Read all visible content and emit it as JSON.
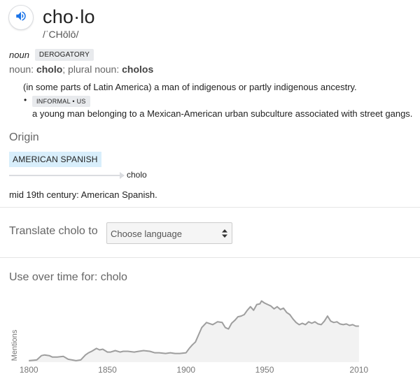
{
  "entry": {
    "headword": "cho·lo",
    "pronunciation": "/ˈCHōlō/"
  },
  "sense": {
    "part_of_speech": "noun",
    "register": "DEROGATORY",
    "forms_prefix": "noun:",
    "singular": "cholo",
    "plural_prefix": "; plural noun:",
    "plural": "cholos",
    "definition_1": "(in some parts of Latin America) a man of indigenous or partly indigenous ancestry.",
    "label_2": "INFORMAL • US",
    "definition_2": "a young man belonging to a Mexican-American urban subculture associated with street gangs."
  },
  "origin": {
    "title": "Origin",
    "source_language": "AMERICAN SPANISH",
    "target_word": "cholo",
    "text": "mid 19th century: American Spanish."
  },
  "translate": {
    "label": "Translate cholo to",
    "select_placeholder": "Choose language"
  },
  "usage": {
    "title": "Use over time for: cholo",
    "ylabel": "Mentions",
    "ticks": [
      "1800",
      "1850",
      "1900",
      "1950",
      "2010"
    ]
  },
  "colors": {
    "accent": "#1a73e8",
    "etymology_chip": "#d8eefb",
    "chart_line": "#9e9e9e",
    "chart_fill": "#f2f2f2"
  },
  "chart_data": {
    "type": "area",
    "title": "Use over time for: cholo",
    "xlabel": "",
    "ylabel": "Mentions",
    "x_ticks": [
      1800,
      1850,
      1900,
      1950,
      2010
    ],
    "xlim": [
      1795,
      2015
    ],
    "ylim": [
      0,
      100
    ],
    "grid": false,
    "x": [
      1800,
      1805,
      1808,
      1810,
      1813,
      1815,
      1818,
      1822,
      1825,
      1830,
      1833,
      1836,
      1838,
      1840,
      1843,
      1845,
      1847,
      1850,
      1852,
      1855,
      1858,
      1860,
      1863,
      1867,
      1870,
      1873,
      1877,
      1880,
      1883,
      1887,
      1890,
      1893,
      1896,
      1900,
      1902,
      1904,
      1906,
      1908,
      1910,
      1913,
      1917,
      1920,
      1923,
      1925,
      1927,
      1929,
      1931,
      1933,
      1935,
      1937,
      1939,
      1941,
      1943,
      1945,
      1947,
      1948,
      1950,
      1952,
      1954,
      1956,
      1958,
      1960,
      1962,
      1964,
      1966,
      1968,
      1970,
      1972,
      1974,
      1976,
      1978,
      1980,
      1982,
      1984,
      1986,
      1988,
      1990,
      1992,
      1994,
      1996,
      1998,
      2000,
      2002,
      2004,
      2006,
      2008,
      2010
    ],
    "values": [
      2,
      3,
      9,
      10,
      9,
      7,
      7,
      8,
      4,
      2,
      3,
      10,
      13,
      15,
      19,
      17,
      18,
      14,
      14,
      16,
      14,
      15,
      15,
      14,
      15,
      16,
      15,
      13,
      13,
      12,
      13,
      12,
      12,
      13,
      19,
      24,
      28,
      38,
      48,
      55,
      52,
      56,
      55,
      48,
      46,
      54,
      58,
      63,
      64,
      66,
      72,
      77,
      72,
      80,
      81,
      85,
      82,
      80,
      78,
      74,
      77,
      73,
      75,
      69,
      66,
      60,
      55,
      52,
      54,
      52,
      56,
      54,
      56,
      53,
      52,
      57,
      64,
      57,
      55,
      56,
      53,
      52,
      53,
      51,
      52,
      50,
      50
    ]
  }
}
